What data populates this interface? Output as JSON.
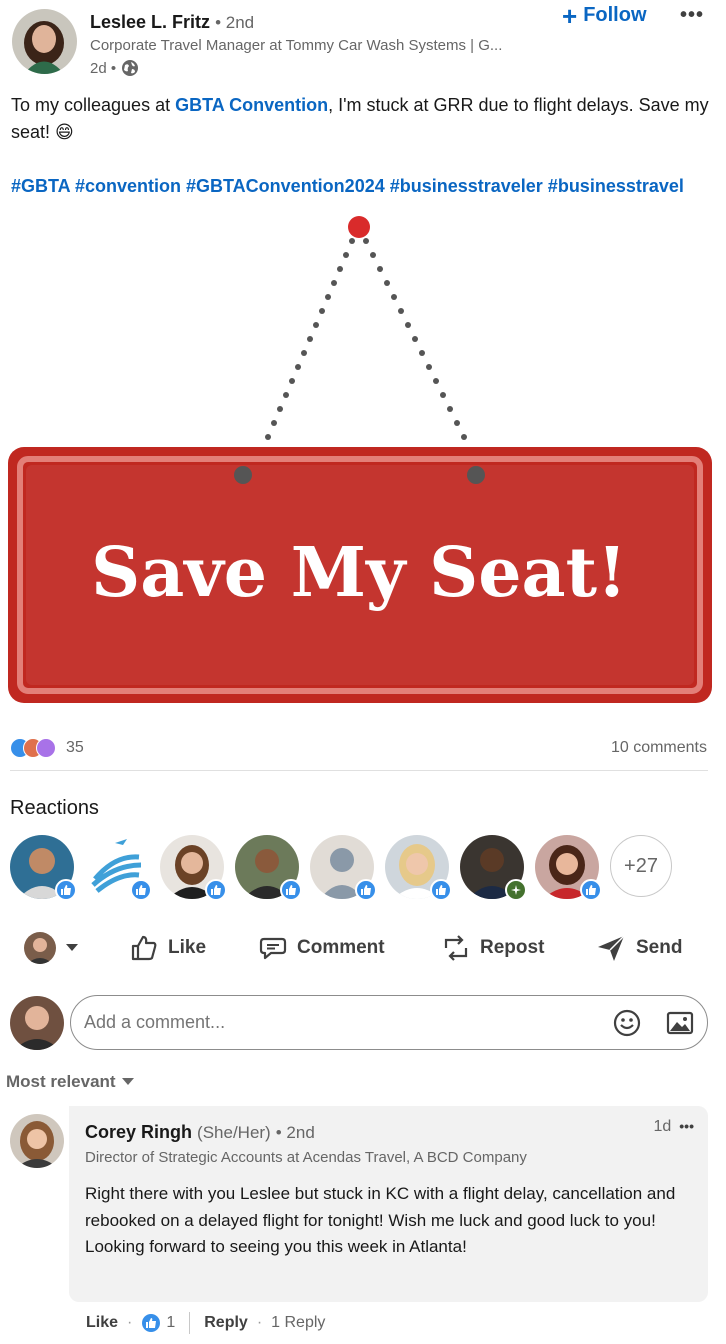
{
  "post": {
    "author": {
      "name": "Leslee L. Fritz",
      "degree": "• 2nd",
      "headline": "Corporate Travel Manager at Tommy Car Wash Systems | G...",
      "age": "2d •"
    },
    "follow_label": "Follow",
    "more_label": "•••",
    "text_before": "To my colleagues at ",
    "mention": "GBTA Convention",
    "text_after": ", I'm stuck at GRR due to flight delays. Save my seat! 😄",
    "hashtags": "#GBTA #convention #GBTAConvention2024 #businesstraveler #businesstravel",
    "image_caption": "Save My Seat!"
  },
  "social": {
    "reaction_count": "35",
    "comments_count": "10 comments",
    "reactions_title": "Reactions",
    "more_reactors": "+27"
  },
  "actions": {
    "like": "Like",
    "comment": "Comment",
    "repost": "Repost",
    "send": "Send"
  },
  "comment_box": {
    "placeholder": "Add a comment..."
  },
  "sort": {
    "label": "Most relevant"
  },
  "comment": {
    "name": "Corey Ringh",
    "pronouns": "(She/Her)",
    "degree": "• 2nd",
    "age": "1d",
    "more": "•••",
    "headline": "Director of Strategic Accounts at Acendas Travel, A BCD Company",
    "text": "Right there with you Leslee but stuck in KC with a flight delay, cancellation and rebooked on a delayed flight for tonight! Wish me luck and good luck to you! Looking forward to seeing you this week in Atlanta!",
    "like": "Like",
    "like_count": "1",
    "reply": "Reply",
    "replies": "1 Reply"
  },
  "colors": {
    "brand_blue": "#0a66c2",
    "sign_red": "#c4352f",
    "muted_text": "#666666"
  }
}
